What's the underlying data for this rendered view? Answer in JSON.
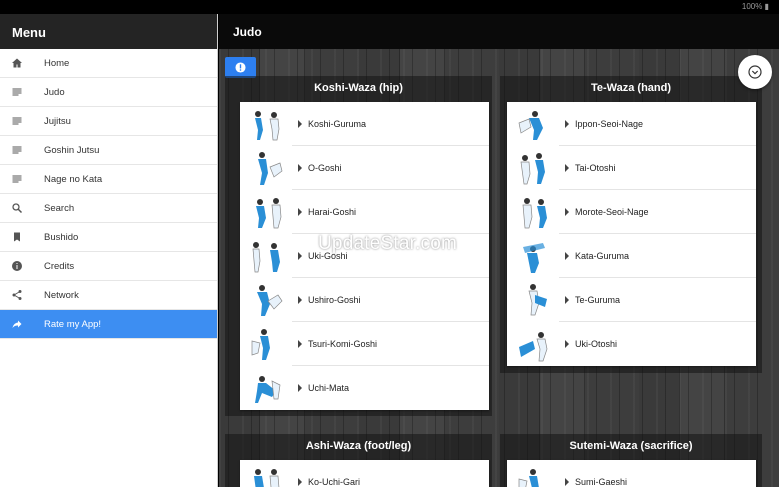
{
  "status": {
    "text": "100% ▮"
  },
  "sidebar": {
    "title": "Menu",
    "items": [
      {
        "label": "Home",
        "icon": "home-icon"
      },
      {
        "label": "Judo",
        "icon": "list-icon"
      },
      {
        "label": "Jujitsu",
        "icon": "list-icon"
      },
      {
        "label": "Goshin Jutsu",
        "icon": "list-icon"
      },
      {
        "label": "Nage no Kata",
        "icon": "list-icon"
      },
      {
        "label": "Search",
        "icon": "search-icon"
      },
      {
        "label": "Bushido",
        "icon": "bookmark-icon"
      },
      {
        "label": "Credits",
        "icon": "info-icon"
      },
      {
        "label": "Network",
        "icon": "share-icon"
      },
      {
        "label": "Rate my App!",
        "icon": "forward-icon",
        "active": true
      }
    ]
  },
  "header": {
    "title": "Judo"
  },
  "colors": {
    "accent": "#3d8ef2",
    "header_bg": "#242424",
    "figure_blue": "#2a8fd6"
  },
  "sections": [
    {
      "title": "Koshi-Waza (hip)",
      "items": [
        "Koshi-Guruma",
        "O-Goshi",
        "Harai-Goshi",
        "Uki-Goshi",
        "Ushiro-Goshi",
        "Tsuri-Komi-Goshi",
        "Uchi-Mata"
      ]
    },
    {
      "title": "Te-Waza (hand)",
      "items": [
        "Ippon-Seoi-Nage",
        "Tai-Otoshi",
        "Morote-Seoi-Nage",
        "Kata-Guruma",
        "Te-Guruma",
        "Uki-Otoshi"
      ]
    },
    {
      "title": "Ashi-Waza (foot/leg)",
      "items": [
        "Ko-Uchi-Gari"
      ]
    },
    {
      "title": "Sutemi-Waza (sacrifice)",
      "items": [
        "Sumi-Gaeshi"
      ]
    }
  ],
  "watermark": "UpdateStar.com"
}
